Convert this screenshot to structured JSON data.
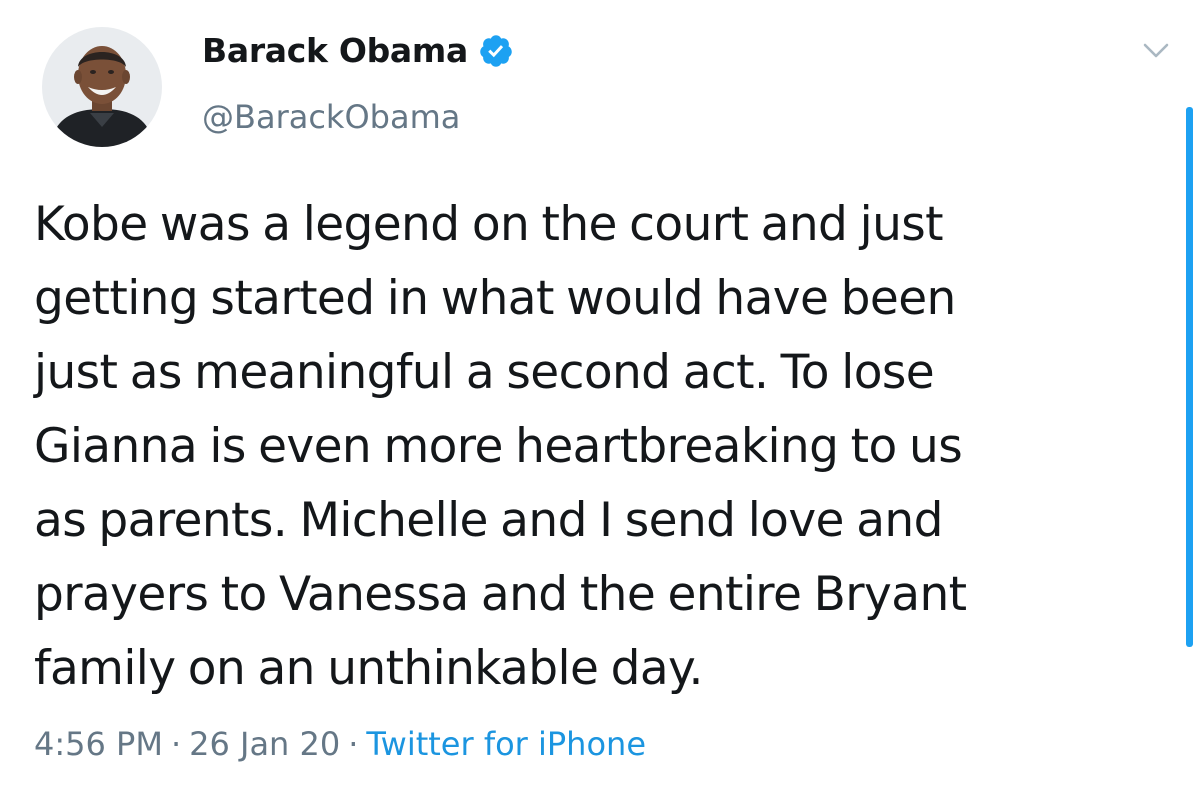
{
  "tweet": {
    "author": {
      "display_name": "Barack Obama",
      "handle": "@BarackObama",
      "verified": true,
      "verified_icon": "verified-badge-icon",
      "avatar": "profile-photo"
    },
    "text_lines": [
      "Kobe was a legend on the court and just",
      "getting started in what would have been",
      "just as meaningful a second act. To lose",
      "Gianna is even more heartbreaking to us",
      "as parents. Michelle and I send love and",
      "prayers to Vanessa and the entire Bryant",
      "family on an unthinkable day."
    ],
    "time": "4:56 PM",
    "date": "26 Jan 20",
    "separator": "·",
    "source": "Twitter for iPhone",
    "menu_icon": "chevron-down-icon"
  },
  "colors": {
    "text": "#14171a",
    "secondary": "#657786",
    "link": "#1b95e0",
    "verified": "#1da1f2",
    "background": "#ffffff"
  }
}
